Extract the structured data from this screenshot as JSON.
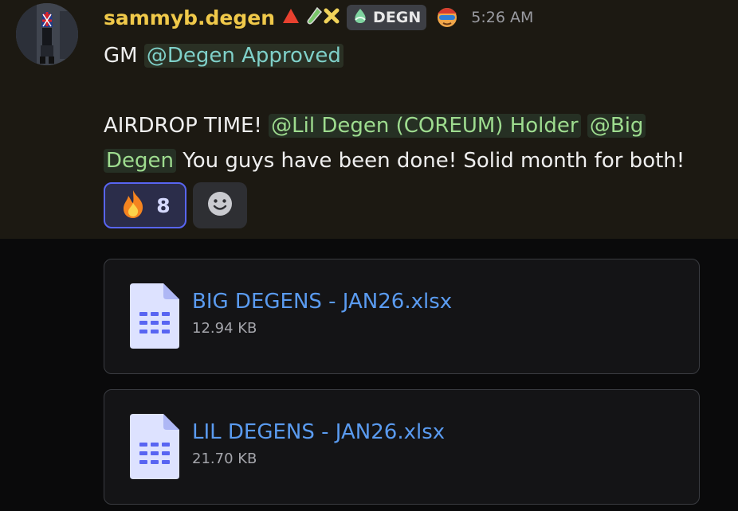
{
  "message": {
    "username": "sammyb.degen",
    "badge_emojis": [
      "red-triangle",
      "test-tube",
      "cross-mark"
    ],
    "server_tag": "DEGN",
    "timestamp": "5:26 AM",
    "line1_text": "GM ",
    "line1_mention": "@Degen Approved",
    "line2_text": "AIRDROP TIME! ",
    "line2_mention1": "@Lil Degen (COREUM) Holder",
    "line2_mention2_part1": "@Big",
    "line2_mention2_part2": "Degen",
    "line2_tail": " You guys have been done! Solid month for both!"
  },
  "reactions": [
    {
      "emoji": "fire",
      "count": "8",
      "active": true
    }
  ],
  "attachments": [
    {
      "name": "BIG DEGENS - JAN26.xlsx",
      "size": "12.94 KB"
    },
    {
      "name": "LIL DEGENS - JAN26.xlsx",
      "size": "21.70 KB"
    }
  ],
  "colors": {
    "username": "#f0c94a",
    "mention": "#7fd0c9",
    "link": "#5a9bf0",
    "reaction_border": "#5865f2"
  }
}
